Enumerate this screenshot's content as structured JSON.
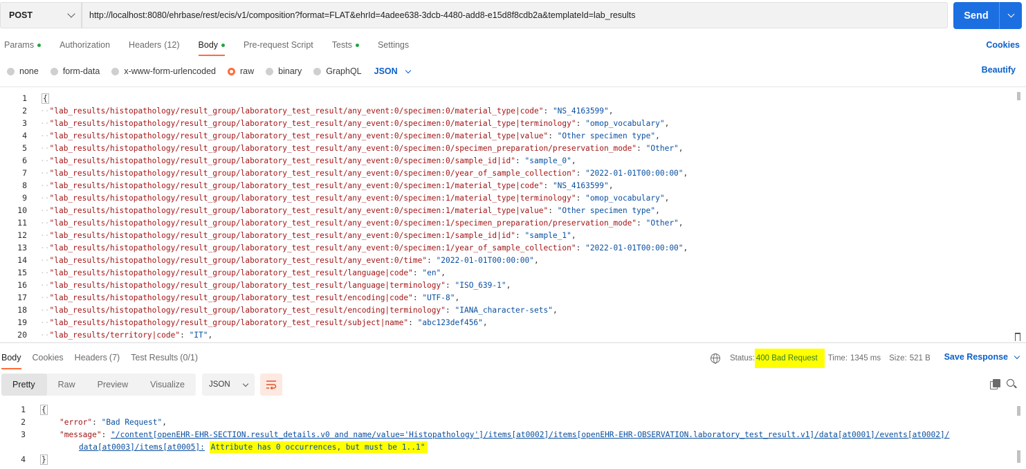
{
  "request": {
    "method": "POST",
    "url": "http://localhost:8080/ehrbase/rest/ecis/v1/composition?format=FLAT&ehrId=4adee638-3dcb-4480-add8-e15d8f8cdb2a&templateId=lab_results",
    "send_label": "Send"
  },
  "request_tabs": [
    {
      "label": "Params",
      "dot": true
    },
    {
      "label": "Authorization"
    },
    {
      "label": "Headers",
      "count": "(12)"
    },
    {
      "label": "Body",
      "dot": true,
      "active": true
    },
    {
      "label": "Pre-request Script"
    },
    {
      "label": "Tests",
      "dot": true
    },
    {
      "label": "Settings"
    }
  ],
  "cookies_label": "Cookies",
  "body_types": {
    "options": [
      "none",
      "form-data",
      "x-www-form-urlencoded",
      "raw",
      "binary",
      "GraphQL"
    ],
    "selected": "raw",
    "format": "JSON",
    "beautify_label": "Beautify"
  },
  "request_body_lines": [
    {
      "n": "1",
      "kind": "open",
      "text": "{"
    },
    {
      "n": "2",
      "key": "\"lab_results/histopathology/result_group/laboratory_test_result/any_event:0/specimen:0/material_type|code\"",
      "val": "\"NS_4163599\""
    },
    {
      "n": "3",
      "key": "\"lab_results/histopathology/result_group/laboratory_test_result/any_event:0/specimen:0/material_type|terminology\"",
      "val": "\"omop_vocabulary\""
    },
    {
      "n": "4",
      "key": "\"lab_results/histopathology/result_group/laboratory_test_result/any_event:0/specimen:0/material_type|value\"",
      "val": "\"Other specimen type\""
    },
    {
      "n": "5",
      "key": "\"lab_results/histopathology/result_group/laboratory_test_result/any_event:0/specimen:0/specimen_preparation/preservation_mode\"",
      "val": "\"Other\""
    },
    {
      "n": "6",
      "key": "\"lab_results/histopathology/result_group/laboratory_test_result/any_event:0/specimen:0/sample_id|id\"",
      "val": "\"sample_0\""
    },
    {
      "n": "7",
      "key": "\"lab_results/histopathology/result_group/laboratory_test_result/any_event:0/specimen:0/year_of_sample_collection\"",
      "val": "\"2022-01-01T00:00:00\""
    },
    {
      "n": "8",
      "key": "\"lab_results/histopathology/result_group/laboratory_test_result/any_event:0/specimen:1/material_type|code\"",
      "val": "\"NS_4163599\""
    },
    {
      "n": "9",
      "key": "\"lab_results/histopathology/result_group/laboratory_test_result/any_event:0/specimen:1/material_type|terminology\"",
      "val": "\"omop_vocabulary\""
    },
    {
      "n": "10",
      "key": "\"lab_results/histopathology/result_group/laboratory_test_result/any_event:0/specimen:1/material_type|value\"",
      "val": "\"Other specimen type\""
    },
    {
      "n": "11",
      "key": "\"lab_results/histopathology/result_group/laboratory_test_result/any_event:0/specimen:1/specimen_preparation/preservation_mode\"",
      "val": "\"Other\""
    },
    {
      "n": "12",
      "key": "\"lab_results/histopathology/result_group/laboratory_test_result/any_event:0/specimen:1/sample_id|id\"",
      "val": "\"sample_1\""
    },
    {
      "n": "13",
      "key": "\"lab_results/histopathology/result_group/laboratory_test_result/any_event:0/specimen:1/year_of_sample_collection\"",
      "val": "\"2022-01-01T00:00:00\""
    },
    {
      "n": "14",
      "key": "\"lab_results/histopathology/result_group/laboratory_test_result/any_event:0/time\"",
      "val": "\"2022-01-01T00:00:00\""
    },
    {
      "n": "15",
      "key": "\"lab_results/histopathology/result_group/laboratory_test_result/language|code\"",
      "val": "\"en\""
    },
    {
      "n": "16",
      "key": "\"lab_results/histopathology/result_group/laboratory_test_result/language|terminology\"",
      "val": "\"ISO_639-1\""
    },
    {
      "n": "17",
      "key": "\"lab_results/histopathology/result_group/laboratory_test_result/encoding|code\"",
      "val": "\"UTF-8\""
    },
    {
      "n": "18",
      "key": "\"lab_results/histopathology/result_group/laboratory_test_result/encoding|terminology\"",
      "val": "\"IANA_character-sets\""
    },
    {
      "n": "19",
      "key": "\"lab_results/histopathology/result_group/laboratory_test_result/subject|name\"",
      "val": "\"abc123def456\""
    },
    {
      "n": "20",
      "key": "\"lab_results/territory|code\"",
      "val": "\"IT\""
    }
  ],
  "response_tabs": [
    {
      "label": "Body",
      "active": true
    },
    {
      "label": "Cookies"
    },
    {
      "label": "Headers",
      "count": "(7)"
    },
    {
      "label": "Test Results",
      "count": "(0/1)"
    }
  ],
  "response_status": {
    "status_label": "Status:",
    "status_value": "400 Bad Request",
    "time_label": "Time:",
    "time_value": "1345 ms",
    "size_label": "Size:",
    "size_value": "521 B",
    "save_label": "Save Response"
  },
  "response_view": {
    "modes": [
      "Pretty",
      "Raw",
      "Preview",
      "Visualize"
    ],
    "active_mode": "Pretty",
    "format": "JSON"
  },
  "response_body": {
    "line1": {
      "n": "1",
      "text": "{"
    },
    "line2": {
      "n": "2",
      "key": "\"error\"",
      "val": "\"Bad Request\""
    },
    "line3": {
      "n": "3",
      "key": "\"message\"",
      "val_link": "\"/content[openEHR-EHR-SECTION.result_details.v0 and name/value='Histopathology']/items[at0002]/items[openEHR-EHR-OBSERVATION.laboratory_test_result.v1]/data[at0001]/events[at0002]/",
      "val_link2": "data[at0003]/items[at0005]:",
      "val_highlight": "Attribute has 0 occurrences, but must be 1..1\""
    },
    "line4": {
      "n": "4",
      "text": "}"
    }
  },
  "colors": {
    "accent": "#ff6c37",
    "send": "#1c6fe0",
    "link": "#0b60c9",
    "highlight": "#ffff00",
    "json_key": "#a31515",
    "json_string": "#0a4fa0"
  }
}
